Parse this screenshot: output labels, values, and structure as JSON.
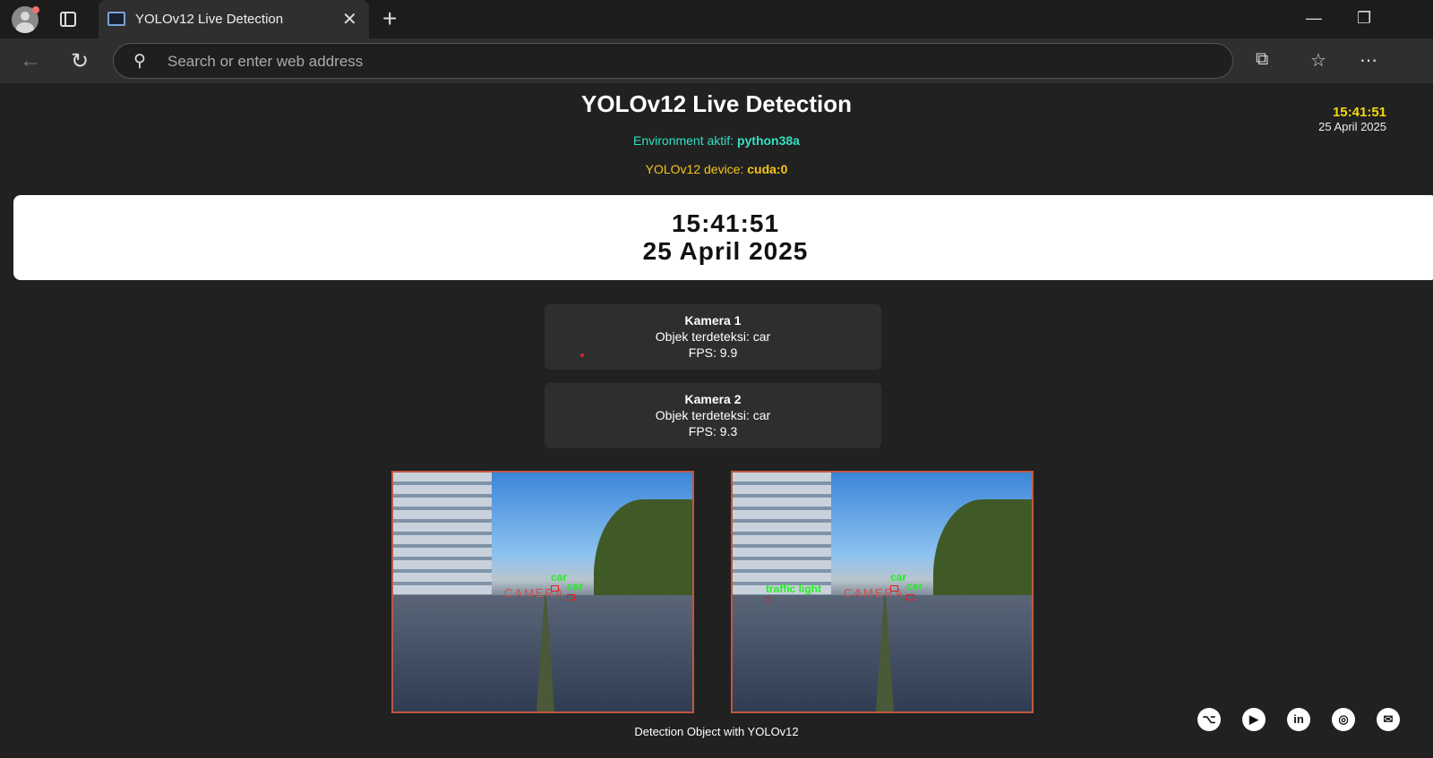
{
  "browser": {
    "tab_title": "YOLOv12 Live Detection",
    "address_placeholder": "Search or enter web address",
    "icons": [
      "profile-icon",
      "tabs-icon",
      "back-icon",
      "refresh-icon",
      "search-icon",
      "extensions-icon",
      "favorites-icon",
      "more-icon"
    ]
  },
  "header": {
    "title": "YOLOv12 Live Detection",
    "env_label": "Environment aktif: ",
    "env_value": "python38a",
    "device_label": "YOLOv12 device: ",
    "device_value": "cuda:0"
  },
  "mini_clock": {
    "time": "15:41:51",
    "date": "25 April 2025"
  },
  "clock": {
    "time": "15:41:51",
    "date": "25 April 2025"
  },
  "cameras": [
    {
      "name": "Kamera 1",
      "objects": "Objek terdeteksi: car",
      "fps": "FPS: 9.9",
      "overlay": {
        "camera": "CAMERA",
        "labels": [
          "car",
          "car"
        ]
      }
    },
    {
      "name": "Kamera 2",
      "objects": "Objek terdeteksi: car",
      "fps": "FPS: 9.3",
      "overlay": {
        "camera": "CAMERA",
        "labels": [
          "car",
          "car",
          "traffic light"
        ]
      }
    }
  ],
  "footer": {
    "caption": "Detection Object with YOLOv12",
    "social": [
      "github",
      "youtube",
      "linkedin",
      "instagram",
      "email"
    ]
  },
  "colors": {
    "env": "#31e0c1",
    "device": "#f5c518",
    "clock_accent": "#f5d90a",
    "feed_border": "#c0573f"
  }
}
